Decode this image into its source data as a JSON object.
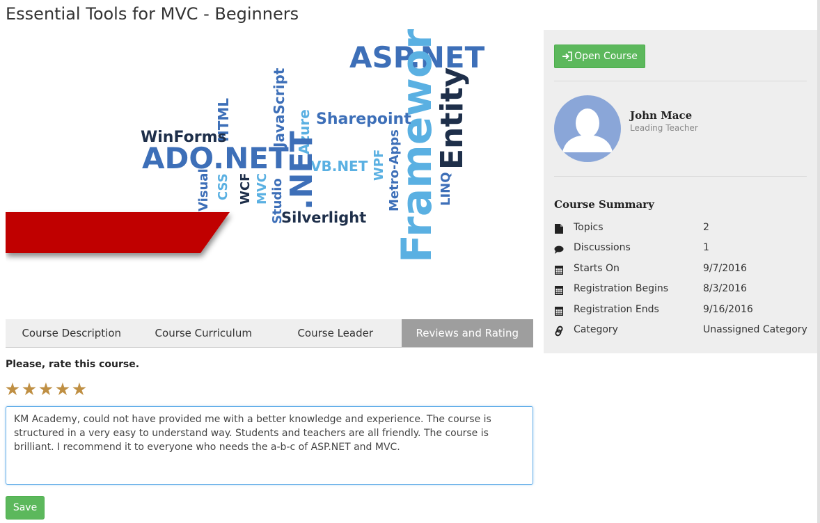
{
  "page": {
    "title": "Essential Tools for MVC - Beginners"
  },
  "banner": {
    "words": [
      "ASP.NET",
      "Framework",
      "Entity",
      "Sharepoint",
      "JavaScript",
      "HTML",
      "WinForms",
      "ADO.NET",
      "Azure",
      "VB.NET",
      "WPF",
      "Metro-Apps",
      "LINQ",
      "Visual",
      "CSS",
      "WCF",
      "MVC",
      "Studio",
      ".NET",
      "Silverlight"
    ],
    "colors": {
      "dark": "#1e2f4a",
      "blue": "#3d6fb8",
      "light": "#5ab0e2",
      "red": "#c00000"
    }
  },
  "tabs": [
    {
      "label": "Course Description",
      "active": false
    },
    {
      "label": "Course Curriculum",
      "active": false
    },
    {
      "label": "Course Leader",
      "active": false
    },
    {
      "label": "Reviews and Rating",
      "active": true
    }
  ],
  "review": {
    "prompt": "Please, rate this course.",
    "rating": 5,
    "max_rating": 5,
    "text": "KM Academy, could not have provided me with a better knowledge and experience. The course is structured in a very easy to understand way. Students and teachers are all friendly. The course is brilliant. I recommend it to everyone who needs the a-b-c of ASP.NET and MVC.",
    "save_label": "Save"
  },
  "sidebar": {
    "open_course_label": "Open Course",
    "teacher": {
      "name": "John Mace",
      "role": "Leading Teacher"
    },
    "summary_title": "Course Summary",
    "summary": [
      {
        "icon": "file-icon",
        "label": "Topics",
        "value": "2"
      },
      {
        "icon": "comments-icon",
        "label": "Discussions",
        "value": "1"
      },
      {
        "icon": "calendar-icon",
        "label": "Starts On",
        "value": "9/7/2016"
      },
      {
        "icon": "calendar-icon",
        "label": "Registration Begins",
        "value": "8/3/2016"
      },
      {
        "icon": "calendar-icon",
        "label": "Registration Ends",
        "value": "9/16/2016"
      },
      {
        "icon": "link-icon",
        "label": "Category",
        "value": "Unassigned Category"
      }
    ]
  },
  "colors": {
    "success": "#5cb85c",
    "star": "#bf8f43",
    "tab_active": "#9e9e9e",
    "sidebar_bg": "#eeeeee"
  }
}
